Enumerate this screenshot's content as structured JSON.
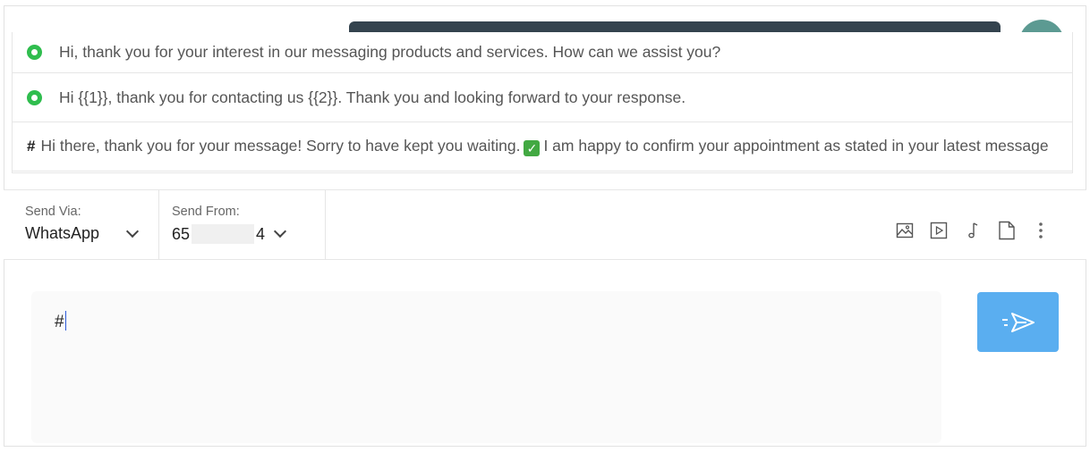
{
  "templates": [
    {
      "type": "whatsapp-icon",
      "text": "Hi, thank you for your interest in our messaging products and services. How can we assist you?"
    },
    {
      "type": "whatsapp-icon",
      "text": "Hi {{1}}, thank you for contacting us {{2}}. Thank you and looking forward to your response."
    },
    {
      "type": "hash",
      "prefix": "#",
      "text_before": "Hi there, thank you for your message! Sorry to have kept you waiting.",
      "emoji": "✓",
      "text_after": "I am happy to confirm your appointment as stated in your latest message"
    }
  ],
  "send_via": {
    "label": "Send Via:",
    "value": "WhatsApp"
  },
  "send_from": {
    "label": "Send From:",
    "value_start": "65",
    "value_end": "4"
  },
  "toolbar_icons": [
    "image-icon",
    "video-icon",
    "audio-icon",
    "document-icon",
    "more-vertical-icon"
  ],
  "composer": {
    "value": "#"
  },
  "colors": {
    "send_button": "#5aaef0",
    "whatsapp_green": "#2fbd4e",
    "chat_header": "#34434e"
  }
}
